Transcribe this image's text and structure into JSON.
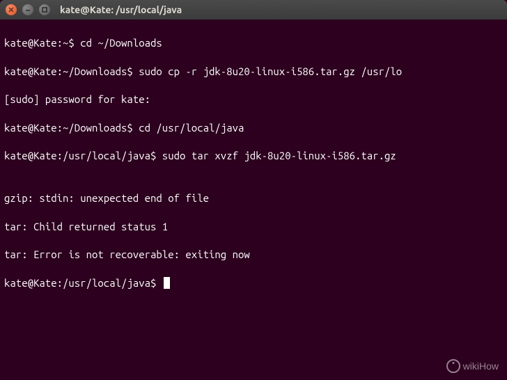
{
  "titlebar": {
    "title": "kate@Kate: /usr/local/java"
  },
  "terminal": {
    "lines": [
      "kate@Kate:~$ cd ~/Downloads",
      "kate@Kate:~/Downloads$ sudo cp -r jdk-8u20-linux-i586.tar.gz /usr/lo",
      "[sudo] password for kate:",
      "kate@Kate:~/Downloads$ cd /usr/local/java",
      "kate@Kate:/usr/local/java$ sudo tar xvzf jdk-8u20-linux-i586.tar.gz",
      "",
      "gzip: stdin: unexpected end of file",
      "tar: Child returned status 1",
      "tar: Error is not recoverable: exiting now"
    ],
    "current_prompt": "kate@Kate:/usr/local/java$ "
  },
  "watermark": {
    "text": "wikiHow"
  }
}
